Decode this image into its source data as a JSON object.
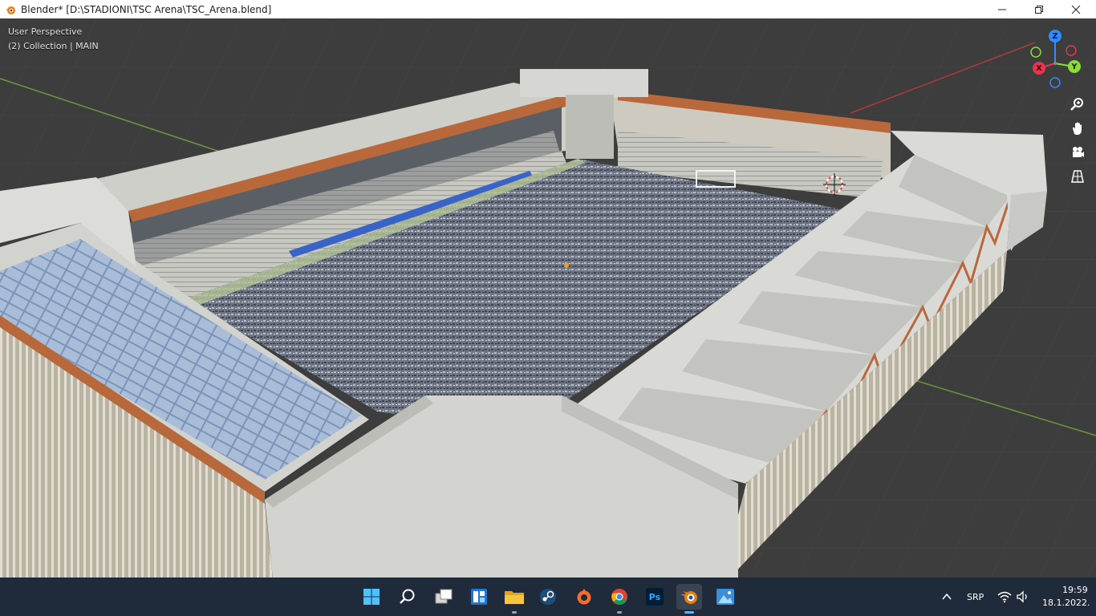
{
  "window": {
    "title": "Blender* [D:\\STADIONI\\TSC Arena\\TSC_Arena.blend]",
    "controls": [
      "minimize",
      "restore",
      "close"
    ]
  },
  "viewport": {
    "perspective_label": "User Perspective",
    "collection_label": "(2) Collection | MAIN",
    "gizmo": {
      "z": "Z",
      "y": "Y",
      "x": "X"
    },
    "nav_tools": [
      "zoom-icon",
      "pan-hand-icon",
      "camera-icon",
      "grid-ortho-icon"
    ],
    "colors": {
      "axis_x": "#e8364e",
      "axis_y": "#8bdc3c",
      "axis_z": "#2f8cff",
      "background": "#3d3d3d"
    }
  },
  "taskbar": {
    "apps": [
      "windows-start-icon",
      "search-icon",
      "task-view-icon",
      "widgets-icon",
      "file-explorer-icon",
      "steam-icon",
      "origin-icon",
      "chrome-icon",
      "photoshop-icon",
      "blender-icon",
      "photos-icon"
    ],
    "photoshop_label": "Ps",
    "tray": {
      "language": "SRP",
      "time": "19:59",
      "date": "18.1.2022."
    }
  }
}
